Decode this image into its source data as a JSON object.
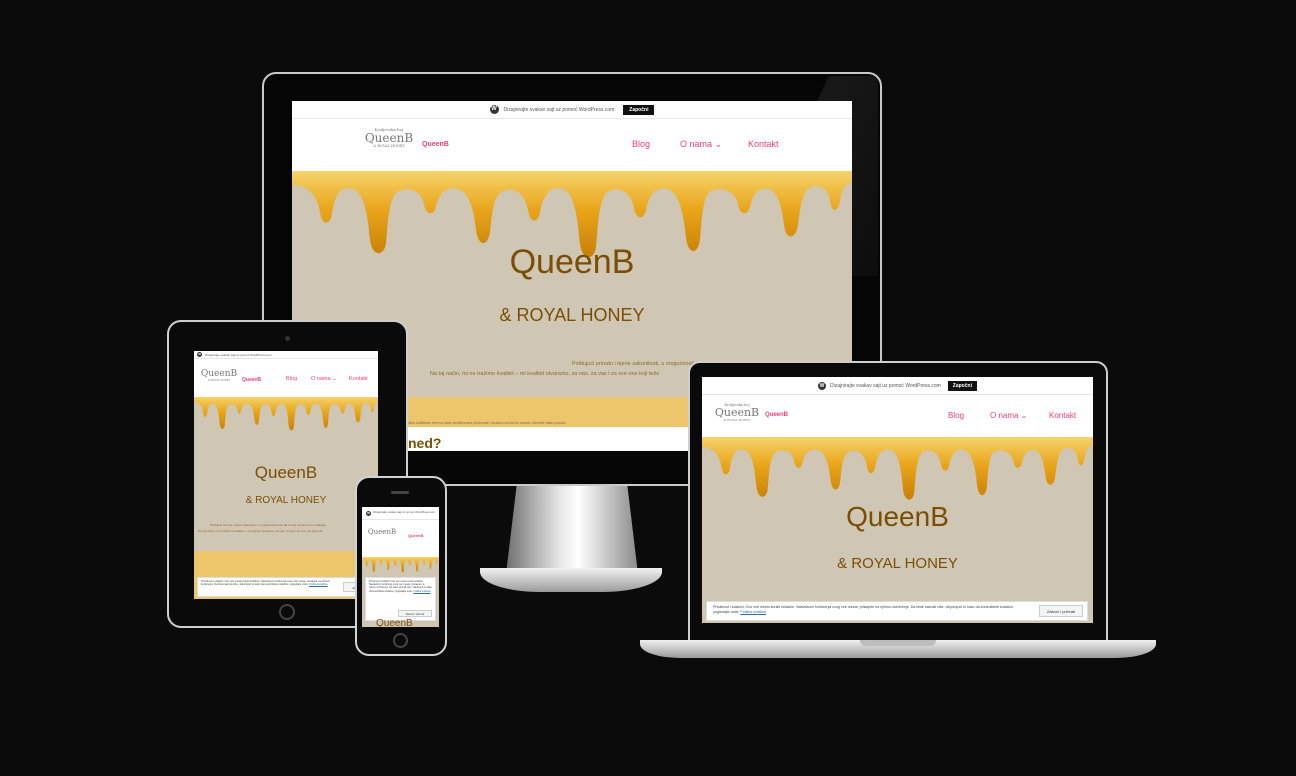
{
  "wp_banner": {
    "text": "Dizajnirajte svakav sajt uz pomoć WordPress.com",
    "signup": "Započni"
  },
  "site": {
    "logo_small": "Kraljevska hoj",
    "logo_big": "QueenB",
    "logo_tag": "& ROYAL HONEY",
    "title": "QueenB",
    "nav": {
      "blog": "Blog",
      "about": "O nama ⌄",
      "contact": "Kontakt"
    },
    "hero_title": "QueenB",
    "hero_subtitle": "& ROYAL HONEY",
    "hero_text_1": "Poštujući prirodu i njene zakonitosti, u mogućnosti smo da od nje uzmemo ono najbolje",
    "hero_text_2": "Na taj način, mi ne tražimo kvalitet – mi kvalitet stvaramo, za nas, za vas i za sve one koji teže",
    "section_heading_fragment": "ned?",
    "phone_heading_fragment": "QueenB",
    "small_strip_text": "Naručite kvalitetan med uz naše sertifikovane proizvode i dostavu na kućnu adresu. Istražite našu ponudu."
  },
  "cookie": {
    "text": "Privatnost i kolačići: Ovo veb mesto koristi kolačiće. Nastavkom korišćenja ovog veb mesta, pristajete na njihovo korišćenje. Da biste saznali više, uključujući to kako da kontrolišete kolačiće, pogledajte ovde:",
    "link": "Politika kolačića",
    "button": "Zatvori i prihvati",
    "button_short": "Zatvori"
  },
  "colors": {
    "background": "#0c0b0b",
    "accent_pink": "#ec407a",
    "hero_bg": "#cfc6b3",
    "honey": "#edc56a",
    "brown_text": "#7a4f05"
  }
}
